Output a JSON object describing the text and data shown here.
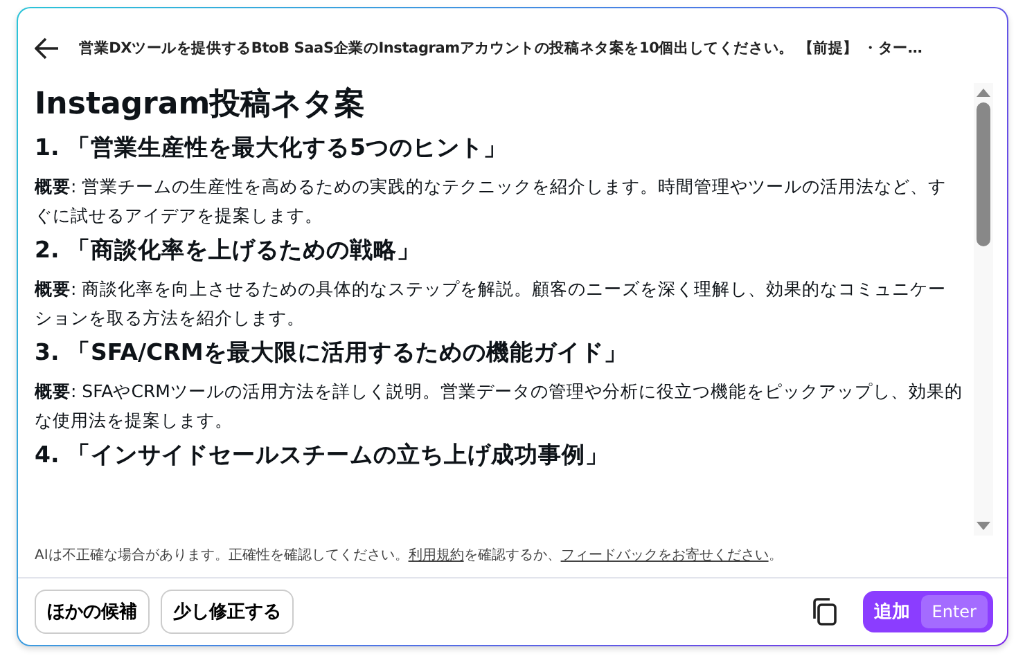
{
  "header": {
    "prompt": "営業DXツールを提供するBtoB SaaS企業のInstagramアカウントの投稿ネタ案を10個出してください。 【前提】 ・ター…"
  },
  "content": {
    "title": "Instagram投稿ネタ案",
    "items": [
      {
        "heading": "1. 「営業生産性を最大化する5つのヒント」",
        "summary": "**概要**: 営業チームの生産性を高めるための実践的なテクニックを紹介します。時間管理やツールの活用法など、すぐに試せるアイデアを提案します。"
      },
      {
        "heading": "2. 「商談化率を上げるための戦略」",
        "summary": "**概要**: 商談化率を向上させるための具体的なステップを解説。顧客のニーズを深く理解し、効果的なコミュニケーションを取る方法を紹介します。"
      },
      {
        "heading": "3. 「SFA/CRMを最大限に活用するための機能ガイド」",
        "summary": "**概要**: SFAやCRMツールの活用方法を詳しく説明。営業データの管理や分析に役立つ機能をピックアップし、効果的な使用法を提案します。"
      },
      {
        "heading": "4. 「インサイドセールスチームの立ち上げ成功事例」"
      }
    ]
  },
  "disclaimer": {
    "text": "AIは不正確な場合があります。正確性を確認してください。",
    "terms_link": "利用規約",
    "middle": "を確認するか、",
    "feedback_link": "フィードバックをお寄せください",
    "end": "。"
  },
  "buttons": [
    {
      "label": "ほかの候補"
    },
    {
      "label": "少し修正する"
    }
  ],
  "add_button": {
    "label": "追加",
    "shortcut": "Enter"
  }
}
